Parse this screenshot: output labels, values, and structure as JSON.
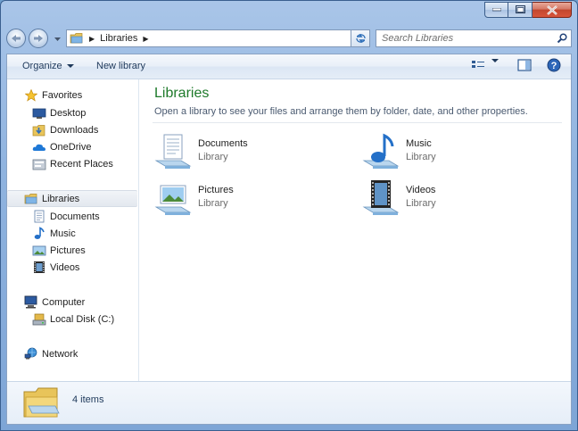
{
  "window": {
    "caption_buttons": [
      "minimize",
      "maximize",
      "close"
    ]
  },
  "address": {
    "breadcrumb": [
      "Libraries"
    ],
    "search_placeholder": "Search Libraries"
  },
  "toolbar": {
    "organize_label": "Organize",
    "new_library_label": "New library"
  },
  "nav": {
    "favorites": {
      "label": "Favorites",
      "items": [
        {
          "label": "Desktop",
          "icon": "desktop-icon"
        },
        {
          "label": "Downloads",
          "icon": "downloads-icon"
        },
        {
          "label": "OneDrive",
          "icon": "onedrive-icon"
        },
        {
          "label": "Recent Places",
          "icon": "recent-places-icon"
        }
      ]
    },
    "libraries": {
      "label": "Libraries",
      "items": [
        {
          "label": "Documents",
          "icon": "documents-icon"
        },
        {
          "label": "Music",
          "icon": "music-icon"
        },
        {
          "label": "Pictures",
          "icon": "pictures-icon"
        },
        {
          "label": "Videos",
          "icon": "videos-icon"
        }
      ]
    },
    "computer": {
      "label": "Computer",
      "items": [
        {
          "label": "Local Disk (C:)",
          "icon": "local-disk-icon"
        }
      ]
    },
    "network": {
      "label": "Network"
    }
  },
  "content": {
    "title": "Libraries",
    "description": "Open a library to see your files and arrange them by folder, date, and other properties.",
    "items": [
      {
        "name": "Documents",
        "type": "Library",
        "icon": "documents-library-icon"
      },
      {
        "name": "Music",
        "type": "Library",
        "icon": "music-library-icon"
      },
      {
        "name": "Pictures",
        "type": "Library",
        "icon": "pictures-library-icon"
      },
      {
        "name": "Videos",
        "type": "Library",
        "icon": "videos-library-icon"
      }
    ]
  },
  "status": {
    "item_count": "4 items"
  },
  "colors": {
    "title_green": "#1e7a2a",
    "chrome_blue": "#8fb3df"
  }
}
